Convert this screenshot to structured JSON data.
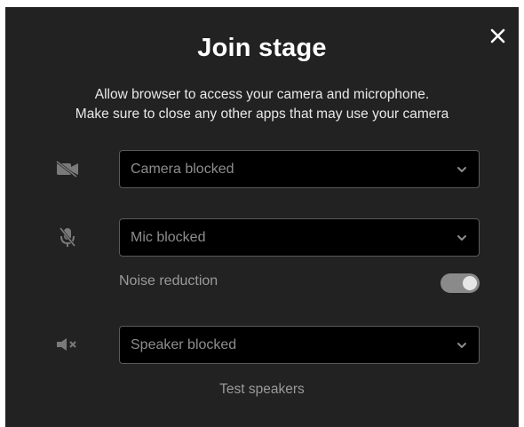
{
  "dialog": {
    "title": "Join stage",
    "description_line1": "Allow browser to access your camera and microphone.",
    "description_line2": "Make sure to close any other apps that may use your camera"
  },
  "camera": {
    "icon": "camera-off-icon",
    "selected": "Camera blocked"
  },
  "microphone": {
    "icon": "mic-off-icon",
    "selected": "Mic blocked"
  },
  "noise_reduction": {
    "label": "Noise reduction",
    "enabled": true
  },
  "speaker": {
    "icon": "speaker-muted-icon",
    "selected": "Speaker blocked"
  },
  "test_speakers_label": "Test speakers",
  "colors": {
    "background": "#222222",
    "select_background": "#000000",
    "muted_text": "#8d8d8d",
    "toggle_on": "#8a8a8a"
  }
}
